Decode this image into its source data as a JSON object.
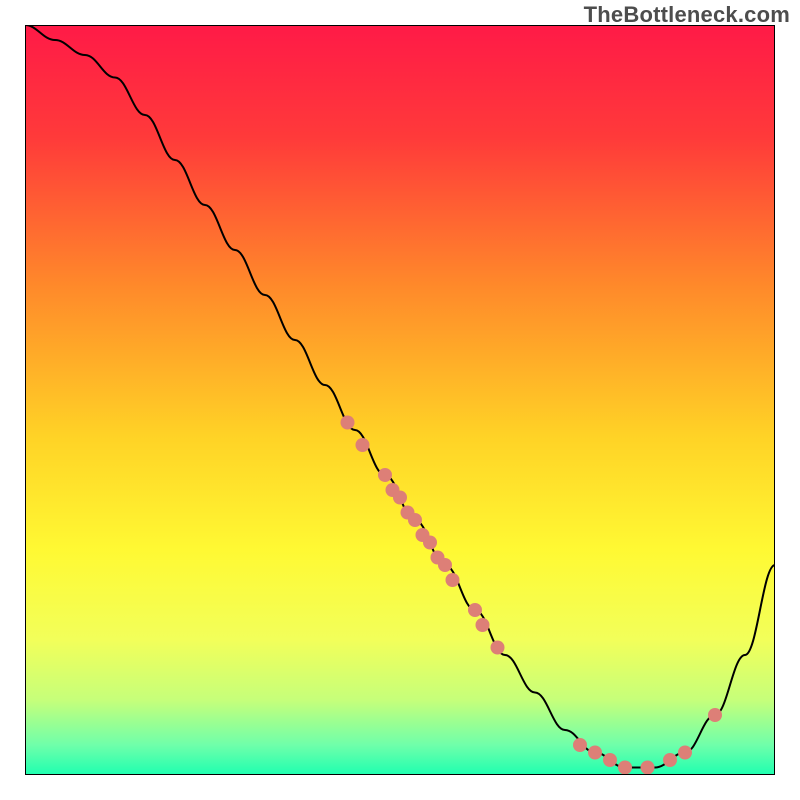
{
  "watermark": "TheBottleneck.com",
  "chart_data": {
    "type": "line",
    "title": "",
    "xlabel": "",
    "ylabel": "",
    "xlim": [
      0,
      100
    ],
    "ylim": [
      0,
      100
    ],
    "curve": {
      "name": "bottleneck-curve",
      "color": "#000000",
      "stroke_width": 2,
      "x": [
        0,
        4,
        8,
        12,
        16,
        20,
        24,
        28,
        32,
        36,
        40,
        44,
        48,
        52,
        56,
        60,
        64,
        68,
        72,
        76,
        80,
        84,
        88,
        92,
        96,
        100
      ],
      "y": [
        100,
        98,
        96,
        93,
        88,
        82,
        76,
        70,
        64,
        58,
        52,
        46,
        40,
        34,
        28,
        22,
        16,
        11,
        6,
        3,
        1,
        1,
        3,
        8,
        16,
        28
      ]
    },
    "scatter": {
      "name": "data-points",
      "color": "#dd7f77",
      "radius": 7,
      "points": [
        {
          "x": 43,
          "y": 47
        },
        {
          "x": 45,
          "y": 44
        },
        {
          "x": 48,
          "y": 40
        },
        {
          "x": 49,
          "y": 38
        },
        {
          "x": 50,
          "y": 37
        },
        {
          "x": 51,
          "y": 35
        },
        {
          "x": 52,
          "y": 34
        },
        {
          "x": 53,
          "y": 32
        },
        {
          "x": 54,
          "y": 31
        },
        {
          "x": 55,
          "y": 29
        },
        {
          "x": 56,
          "y": 28
        },
        {
          "x": 57,
          "y": 26
        },
        {
          "x": 60,
          "y": 22
        },
        {
          "x": 61,
          "y": 20
        },
        {
          "x": 63,
          "y": 17
        },
        {
          "x": 74,
          "y": 4
        },
        {
          "x": 76,
          "y": 3
        },
        {
          "x": 78,
          "y": 2
        },
        {
          "x": 80,
          "y": 1
        },
        {
          "x": 83,
          "y": 1
        },
        {
          "x": 86,
          "y": 2
        },
        {
          "x": 88,
          "y": 3
        },
        {
          "x": 92,
          "y": 8
        }
      ]
    },
    "background_gradient": {
      "stops": [
        {
          "offset": 0.0,
          "color": "#ff1a47"
        },
        {
          "offset": 0.15,
          "color": "#ff3a3a"
        },
        {
          "offset": 0.35,
          "color": "#ff8a2a"
        },
        {
          "offset": 0.55,
          "color": "#ffd326"
        },
        {
          "offset": 0.7,
          "color": "#fff933"
        },
        {
          "offset": 0.82,
          "color": "#f2ff5a"
        },
        {
          "offset": 0.9,
          "color": "#c6ff7a"
        },
        {
          "offset": 0.96,
          "color": "#6fffaa"
        },
        {
          "offset": 1.0,
          "color": "#1effb0"
        }
      ]
    }
  }
}
